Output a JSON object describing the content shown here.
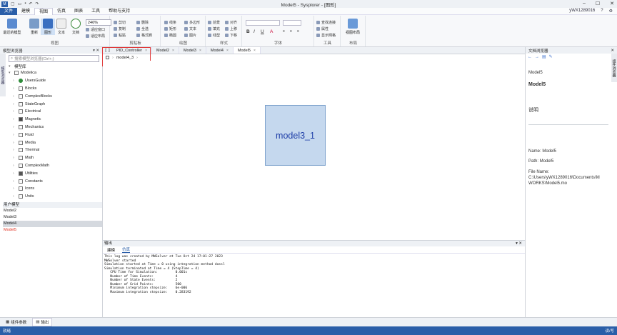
{
  "app": {
    "title": "Model5 - Sysplorer - [图形]",
    "logo": "M",
    "minimize": "–",
    "maximize": "☐",
    "close": "✕"
  },
  "menubar": {
    "items": [
      "文件",
      "建模",
      "视图",
      "仿真",
      "图表",
      "工具",
      "帮助与支持"
    ],
    "active_index": 2,
    "user": "yWX1289016",
    "help": "?",
    "settings": "⚙"
  },
  "ribbon": {
    "view": {
      "recent_label": "最近的模型",
      "rearrange_label": "重新",
      "graph_label": "图形",
      "text_label": "文本",
      "doc_label": "文档",
      "zoom_value": "246%",
      "fit_label": "适应窗口",
      "fit_layout_label": "适应布局",
      "group_label": "视图"
    },
    "clipboard": {
      "cut": "剪切",
      "copy": "复制",
      "paste": "粘贴",
      "delete": "删除",
      "all": "全选",
      "format": "格式刷",
      "group_label": "剪贴板"
    },
    "draw": {
      "line": "线条",
      "rect": "矩形",
      "ellipse": "椭圆",
      "polygon": "多边形",
      "text": "文本",
      "image": "图片",
      "group_label": "绘图"
    },
    "style": {
      "style1": "前景",
      "style2": "填充",
      "style3": "线型",
      "align": "对齐",
      "up": "上移",
      "down": "下移",
      "group_label": "样式"
    },
    "font": {
      "font_name": "",
      "font_size": "",
      "bold": "B",
      "italic": "I",
      "underline": "U",
      "color": "A",
      "group_label": "字体"
    },
    "tools": {
      "find_connect": "查找连接",
      "attributes": "属性",
      "show_grid": "显示网格",
      "group_label": "工具"
    },
    "layout": {
      "label": "视图布局",
      "group_label": "布局"
    }
  },
  "left_panel": {
    "title": "模型浏览器",
    "search_placeholder": "搜索模型浏览器(Ctrl+;)",
    "lib_label": "模型库",
    "side_tab": "模型浏览器",
    "tree": [
      "Modelica",
      "UsersGuide",
      "Blocks",
      "ComplexBlocks",
      "StateGraph",
      "Electrical",
      "Magnetic",
      "Mechanics",
      "Fluid",
      "Media",
      "Thermal",
      "Math",
      "ComplexMath",
      "Utilities",
      "Constants",
      "Icons",
      "Units"
    ],
    "user_header": "用户模型",
    "user_models": [
      "Model2",
      "Model3",
      "Model4",
      "Model5"
    ]
  },
  "tabs": {
    "items": [
      "PID_Controller",
      "Model2",
      "Model3",
      "Model4",
      "Model5"
    ],
    "active_index": 4,
    "sub_model": "model4_3"
  },
  "canvas": {
    "block_label": "model3_1"
  },
  "output": {
    "title": "输出",
    "tabs": [
      "建模",
      "仿真"
    ],
    "active_tab": 1,
    "log": [
      "This log was created by MWSolver at Tue Oct 24 17:01:27 2023",
      "MWSolver started",
      "Simulation started at Time = 0 using integration method dassl",
      "Simulation terminated at Time = 4 (StopTime = 4)",
      "   CPU Time for Simulation:         0.001s",
      "   Number of Time Events:           4",
      "   Number of State Events:          2",
      "   Number of Grid Points:           500",
      "   Minimum integration stepsize:    6e-006",
      "   Maximum integration stepsize:    0.283192"
    ]
  },
  "right_panel": {
    "title": "文档浏览器",
    "side_tab": "组件浏览器",
    "class_small": "Model5",
    "class_title": "Model5",
    "desc_label": "说明",
    "name_line": "Name: Model5",
    "path_line": "Path: Model5",
    "file_label": "File Name:",
    "file_lines": [
      "C:\\Users\\yWX1289016\\Documents\\M",
      "WORKS\\Model5.mo"
    ]
  },
  "bottombar": {
    "items": [
      "组件参数",
      "输出"
    ],
    "active_index": 1
  },
  "statusbar": {
    "left": "就绪",
    "right": "读/写"
  },
  "colors": {
    "accent": "#2a5ea8",
    "block_fill": "#c5d8ee",
    "block_text": "#1f3fa8",
    "highlight_red": "#e03a3a",
    "user_model_red": "#e03020"
  }
}
